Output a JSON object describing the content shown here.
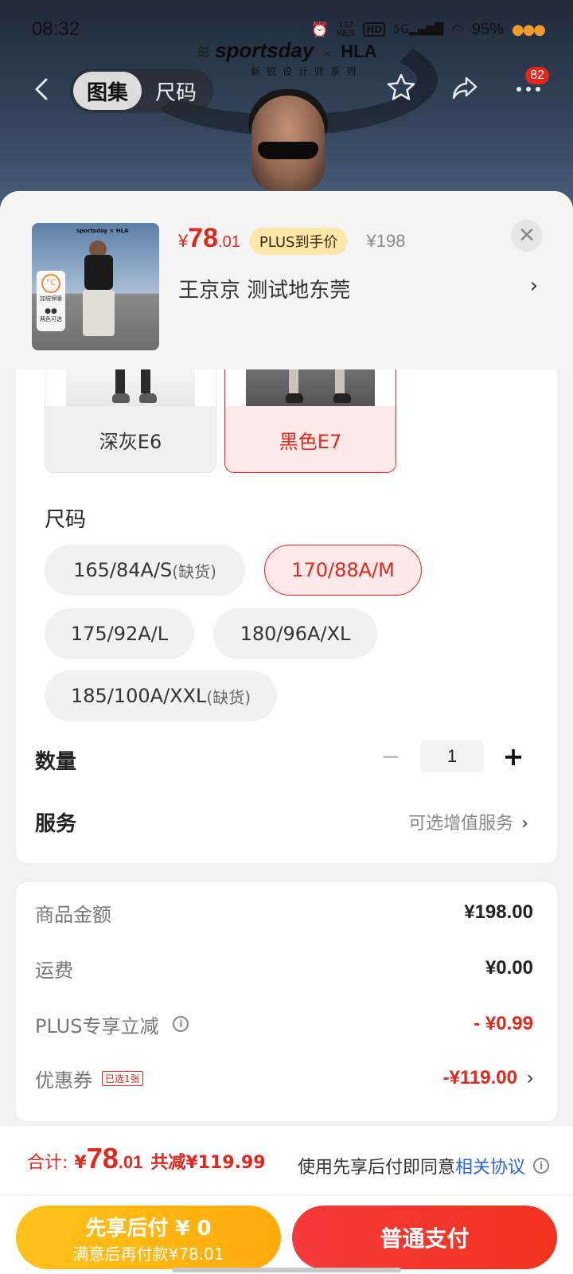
{
  "status": {
    "time": "08:32",
    "speed": "132\nKB/S",
    "hd": "HD",
    "net": "5G",
    "battery": "95%"
  },
  "brand": {
    "name": "sportsday",
    "x": "×",
    "partner": "HLA",
    "series": "新锐设计师系列"
  },
  "nav": {
    "tabs": [
      "图集",
      "尺码"
    ],
    "badge": "82"
  },
  "product": {
    "price_currency": "¥",
    "price_int": "78",
    "price_dec": ".01",
    "plus_tag": "PLUS到手价",
    "original_price": "¥198",
    "address": "王京京  测试地东莞",
    "thumb_badge_1": "加绒保暖",
    "thumb_badge_2": "两色可选",
    "thumb_brand": "sportsday × HLA"
  },
  "colors": [
    {
      "label": "深灰E6",
      "selected": false
    },
    {
      "label": "黑色E7",
      "selected": true
    }
  ],
  "size_title": "尺码",
  "sizes": [
    {
      "label": "165/84A/S",
      "oos": "(缺货)"
    },
    {
      "label": "170/88A/M",
      "oos": ""
    },
    {
      "label": "175/92A/L",
      "oos": ""
    },
    {
      "label": "180/96A/XL",
      "oos": ""
    },
    {
      "label": "185/100A/XXL",
      "oos": "(缺货)"
    }
  ],
  "quantity": {
    "label": "数量",
    "value": "1",
    "minus": "−",
    "plus": "+"
  },
  "service": {
    "label": "服务",
    "hint": "可选增值服务"
  },
  "summary": {
    "goods_label": "商品金额",
    "goods_value": "¥198.00",
    "ship_label": "运费",
    "ship_value": "¥0.00",
    "plus_label": "PLUS专享立减",
    "plus_value": "- ¥0.99",
    "coupon_label": "优惠券",
    "coupon_tag": "已选1张",
    "coupon_value": "-¥119.00"
  },
  "footer": {
    "total_label": "合计:",
    "total_currency": "¥",
    "total_int": "78",
    "total_dec": ".01",
    "total_save": "共减¥119.99",
    "agree_text": "使用先享后付即同意",
    "agree_link": "相关协议",
    "later_line1": "先享后付 ¥ 0",
    "later_line2": "满意后再付款¥78.01",
    "pay_label": "普通支付"
  },
  "colors_theme": {
    "accent": "#e2261b",
    "gold": "#ffb612",
    "link": "#2a66d9"
  }
}
